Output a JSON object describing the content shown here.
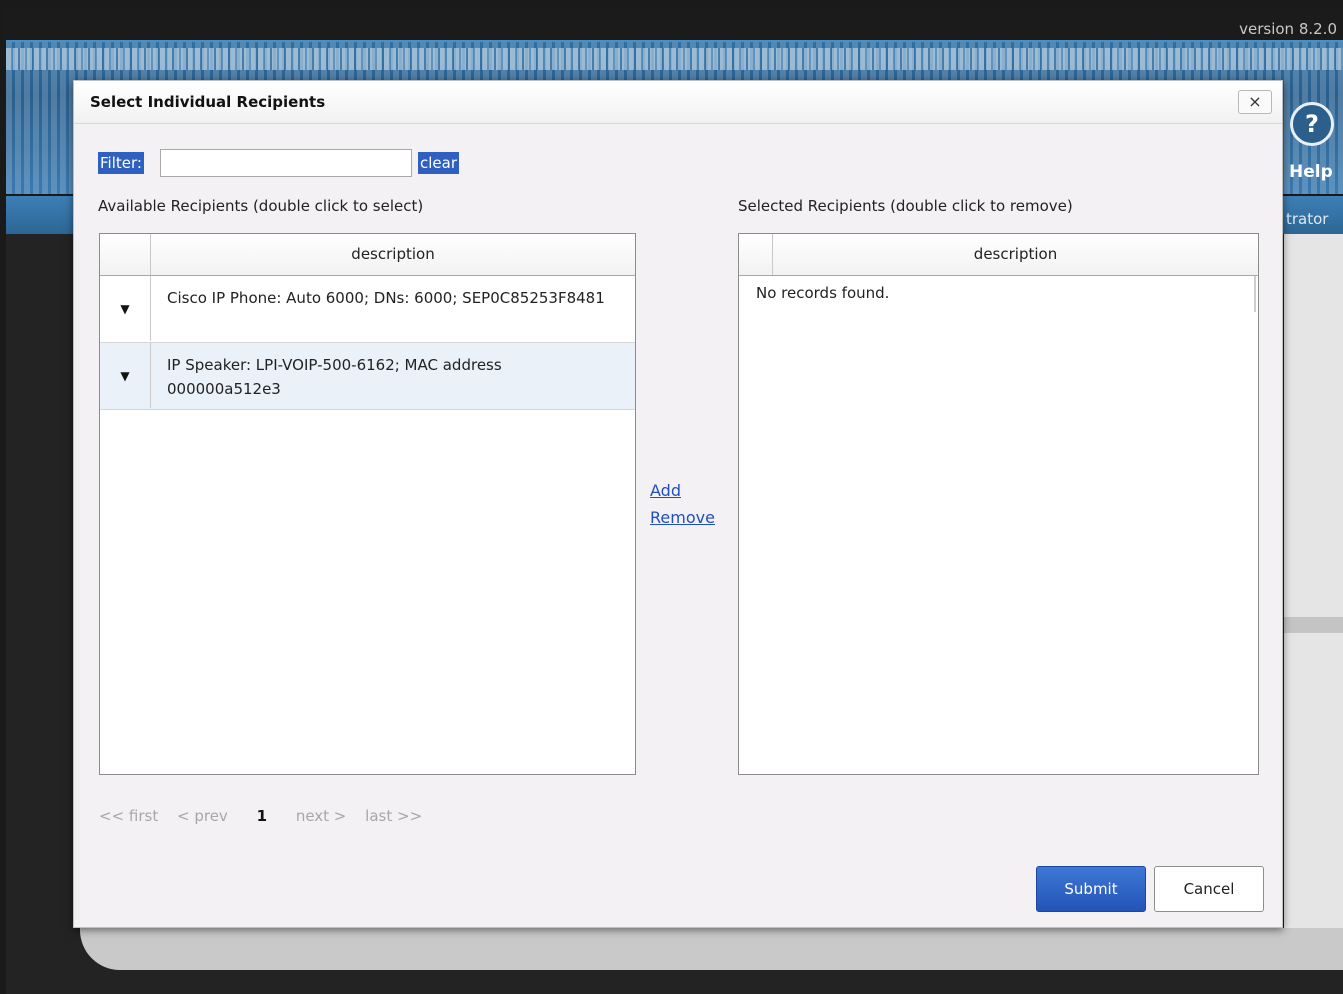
{
  "app": {
    "version": "version 8.2.0",
    "help_label": "Help",
    "help_icon": "?",
    "nav_partial_label": "trator"
  },
  "dialog": {
    "title": "Select Individual Recipients",
    "close_label": "×",
    "filter": {
      "label": "Filter:",
      "value": "",
      "clear_label": "clear"
    },
    "available": {
      "label": "Available Recipients (double click to select)",
      "column_header": "description",
      "rows": [
        {
          "toggle": "▼",
          "description": "Cisco IP Phone: Auto 6000; DNs: 6000; SEP0C85253F8481"
        },
        {
          "toggle": "▼",
          "description": "IP Speaker: LPI-VOIP-500-6162; MAC address 000000a512e3"
        }
      ]
    },
    "selected": {
      "label": "Selected Recipients (double click to remove)",
      "column_header": "description",
      "empty_text": "No records found."
    },
    "add_label": "Add",
    "remove_label": "Remove",
    "pager": {
      "first": "<< first",
      "prev": "< prev",
      "current": "1",
      "next": "next >",
      "last": "last >>"
    },
    "submit_label": "Submit",
    "cancel_label": "Cancel"
  },
  "colors": {
    "accent": "#2f5fbf",
    "submit_bg": "#2a5dc4",
    "row_alt": "#eaf1f9",
    "link": "#1f4fbf"
  }
}
